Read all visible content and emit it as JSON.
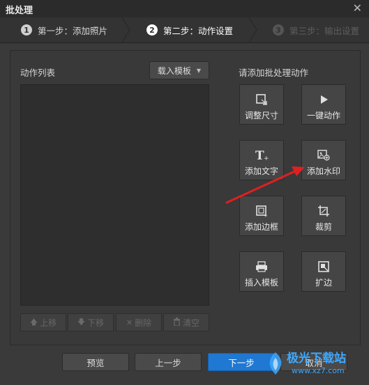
{
  "window": {
    "title": "批处理",
    "close_icon": "close-icon"
  },
  "steps": [
    {
      "number": "1",
      "label": "第一步：添加照片",
      "state": "done"
    },
    {
      "number": "2",
      "label": "第二步：动作设置",
      "state": "active"
    },
    {
      "number": "3",
      "label": "第三步：输出设置",
      "state": "disabled"
    }
  ],
  "action_list": {
    "title": "动作列表",
    "template_button": "载入模板",
    "buttons": {
      "up": "上移",
      "down": "下移",
      "delete": "删除",
      "clear": "清空"
    }
  },
  "add_actions": {
    "title": "请添加批处理动作",
    "items": [
      {
        "label": "调整尺寸",
        "icon": "resize-icon"
      },
      {
        "label": "一键动作",
        "icon": "play-icon"
      },
      {
        "label": "添加文字",
        "icon": "text-icon"
      },
      {
        "label": "添加水印",
        "icon": "watermark-icon"
      },
      {
        "label": "添加边框",
        "icon": "border-icon"
      },
      {
        "label": "裁剪",
        "icon": "crop-icon"
      },
      {
        "label": "插入模板",
        "icon": "template-icon"
      },
      {
        "label": "扩边",
        "icon": "expand-icon"
      }
    ]
  },
  "footer": {
    "preview": "预览",
    "prev": "上一步",
    "next": "下一步",
    "cancel": "取消"
  },
  "watermark": {
    "text": "极光下载站",
    "url": "www.xz7.com"
  },
  "colors": {
    "primary": "#1f78d1",
    "arrow": "#e02020"
  }
}
